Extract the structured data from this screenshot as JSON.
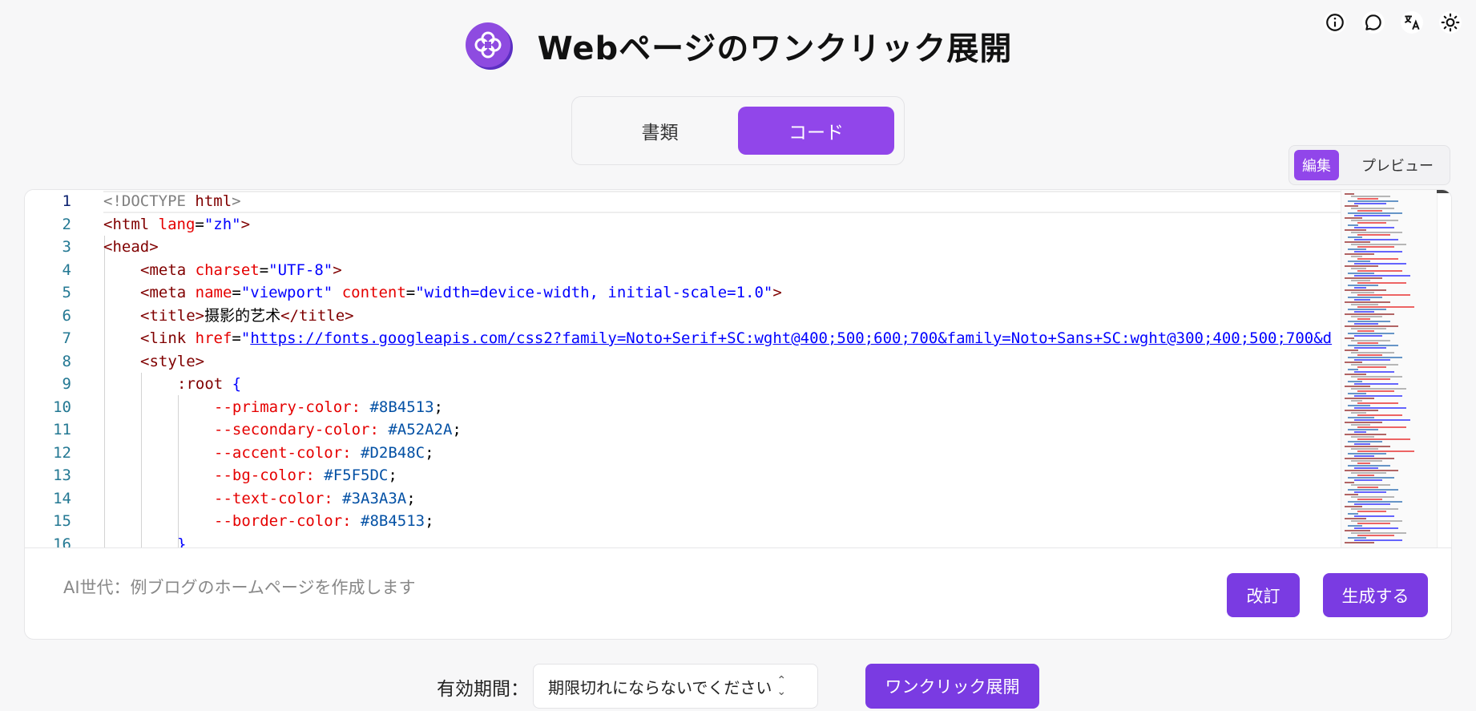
{
  "header": {
    "title": "Webページのワンクリック展開",
    "logo_icon": "clover-logo-icon",
    "top_icons": [
      "info-icon",
      "chat-icon",
      "translate-icon",
      "sun-icon"
    ]
  },
  "mode_tabs": [
    {
      "label": "書類",
      "active": false
    },
    {
      "label": "コード",
      "active": true
    }
  ],
  "view_toggle": {
    "edit_label": "編集",
    "preview_label": "プレビュー"
  },
  "editor": {
    "line_numbers": [
      "1",
      "2",
      "3",
      "4",
      "5",
      "6",
      "7",
      "8",
      "9",
      "10",
      "11",
      "12",
      "13",
      "14",
      "15",
      "16"
    ],
    "current_line": 1,
    "lines": {
      "l1": [
        "<!DOCTYPE",
        " html",
        ">"
      ],
      "l2": [
        "<html",
        " lang",
        "=",
        "\"zh\"",
        ">"
      ],
      "l3": [
        "<head>"
      ],
      "l4": [
        "<meta",
        " charset",
        "=",
        "\"UTF-8\"",
        ">"
      ],
      "l5": [
        "<meta",
        " name",
        "=",
        "\"viewport\"",
        " content",
        "=",
        "\"width=device-width, initial-scale=1.0\"",
        ">"
      ],
      "l6": [
        "<title>",
        "摄影的艺术",
        "</title>"
      ],
      "l7": [
        "<link",
        " href",
        "=",
        "\"",
        "https://fonts.googleapis.com/css2?family=Noto+Serif+SC:wght@400;500;600;700&family=Noto+Sans+SC:wght@300;400;500;700&d"
      ],
      "l8": [
        "<style>"
      ],
      "l9": [
        ":root",
        " {"
      ],
      "l10": [
        "--primary-color:",
        " #8B4513",
        ";"
      ],
      "l11": [
        "--secondary-color:",
        " #A52A2A",
        ";"
      ],
      "l12": [
        "--accent-color:",
        " #D2B48C",
        ";"
      ],
      "l13": [
        "--bg-color:",
        " #F5F5DC",
        ";"
      ],
      "l14": [
        "--text-color:",
        " #3A3A3A",
        ";"
      ],
      "l15": [
        "--border-color:",
        " #8B4513",
        ";"
      ],
      "l16": [
        "}"
      ]
    }
  },
  "prompt": {
    "placeholder": "AI世代：例ブログのホームページを作成します"
  },
  "buttons": {
    "revise": "改訂",
    "generate": "生成する",
    "deploy": "ワンクリック展開"
  },
  "expiry": {
    "label": "有効期間：",
    "selected": "期限切れにならないでください"
  },
  "colors": {
    "accent": "#9146ea",
    "button": "#7a3be2"
  }
}
